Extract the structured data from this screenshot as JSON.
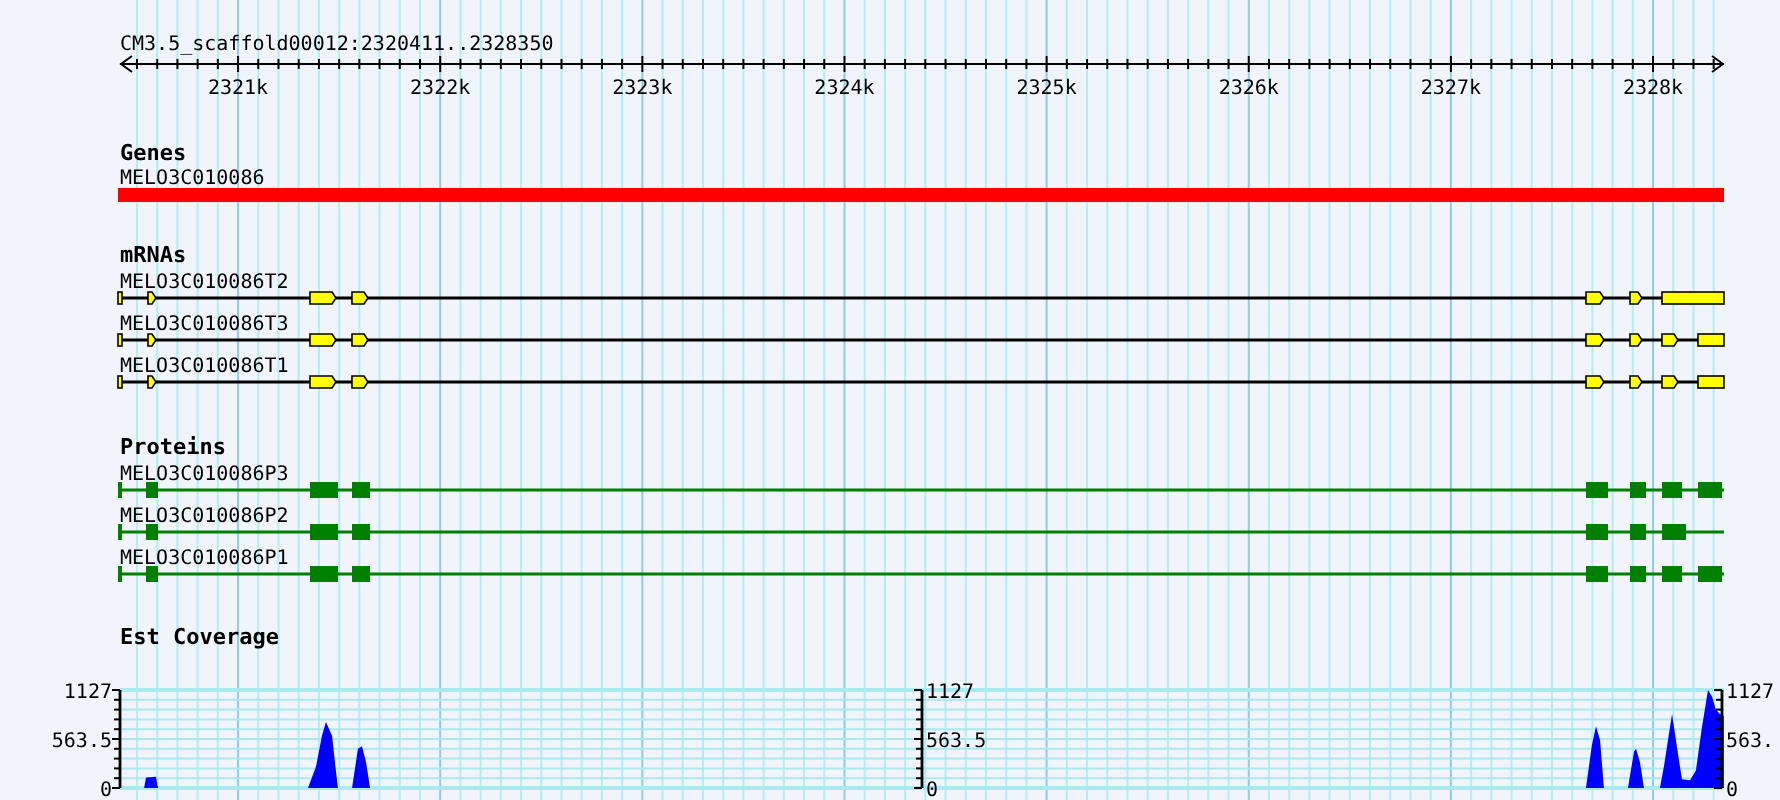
{
  "ruler": {
    "title": "CM3.5_scaffold00012:2320411..2328350",
    "ticks": [
      "2321k",
      "2322k",
      "2323k",
      "2324k",
      "2325k",
      "2326k",
      "2327k",
      "2328k"
    ]
  },
  "tracks": [
    {
      "kind": "gene",
      "title": "Genes",
      "features": [
        {
          "name": "MELO3C010086"
        }
      ]
    },
    {
      "kind": "mrna",
      "title": "mRNAs",
      "features": [
        {
          "name": "MELO3C010086T2"
        },
        {
          "name": "MELO3C010086T3"
        },
        {
          "name": "MELO3C010086T1"
        }
      ]
    },
    {
      "kind": "protein",
      "title": "Proteins",
      "features": [
        {
          "name": "MELO3C010086P3"
        },
        {
          "name": "MELO3C010086P2"
        },
        {
          "name": "MELO3C010086P1"
        }
      ]
    },
    {
      "kind": "coverage",
      "title": "Est Coverage",
      "axes": [
        {
          "labels": [
            "1127",
            "563.5",
            "0"
          ]
        },
        {
          "labels": [
            "1127",
            "563.5",
            "0"
          ]
        },
        {
          "labels": [
            "1127",
            "563.",
            "0"
          ]
        }
      ]
    }
  ]
}
